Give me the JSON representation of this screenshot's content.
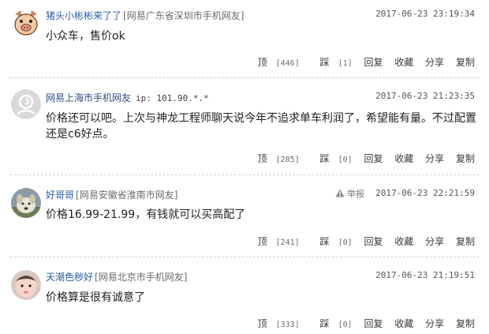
{
  "comments": [
    {
      "user": "猪头小彬彬来了了",
      "source": "[网易广东省深圳市手机网友]",
      "time": "2017-06-23 23:19:34",
      "text": "小众车，售价ok",
      "actions": {
        "up_label": "顶",
        "up_count": "[446]",
        "down_label": "踩",
        "down_count": "[1]",
        "reply": "回复",
        "collect": "收藏",
        "share": "分享",
        "copy": "复制"
      }
    },
    {
      "user": "网易上海市手机网友",
      "ip": "ip: 101.90.*.*",
      "time": "2017-06-23 21:23:35",
      "text": "价格还可以吧。上次与神龙工程师聊天说今年不追求单车利润了，希望能有量。不过配置还是c6好点。",
      "actions": {
        "up_label": "顶",
        "up_count": "[285]",
        "down_label": "踩",
        "down_count": "[0]",
        "reply": "回复",
        "collect": "收藏",
        "share": "分享",
        "copy": "复制"
      }
    },
    {
      "user": "好哥哥",
      "source": "[网易安徽省淮南市网友]",
      "report": "举报",
      "time": "2017-06-23 22:21:59",
      "text": "价格16.99-21.99，有钱就可以买高配了",
      "actions": {
        "up_label": "顶",
        "up_count": "[241]",
        "down_label": "踩",
        "down_count": "[0]",
        "reply": "回复",
        "collect": "收藏",
        "share": "分享",
        "copy": "复制"
      }
    },
    {
      "user": "天潮色秽好",
      "source": "[网易北京市手机网友]",
      "time": "2017-06-23 21:19:51",
      "text": "价格算是很有诚意了",
      "actions": {
        "up_label": "顶",
        "up_count": "[333]",
        "down_label": "踩",
        "down_count": "[0]",
        "reply": "回复",
        "collect": "收藏",
        "share": "分享",
        "copy": "复制"
      }
    }
  ],
  "icons": {
    "avatar_1": "pig-face-icon",
    "avatar_2": "default-user-icon",
    "avatar_3": "dog-photo-icon",
    "avatar_4": "baby-photo-icon",
    "report": "warning-triangle-icon"
  }
}
